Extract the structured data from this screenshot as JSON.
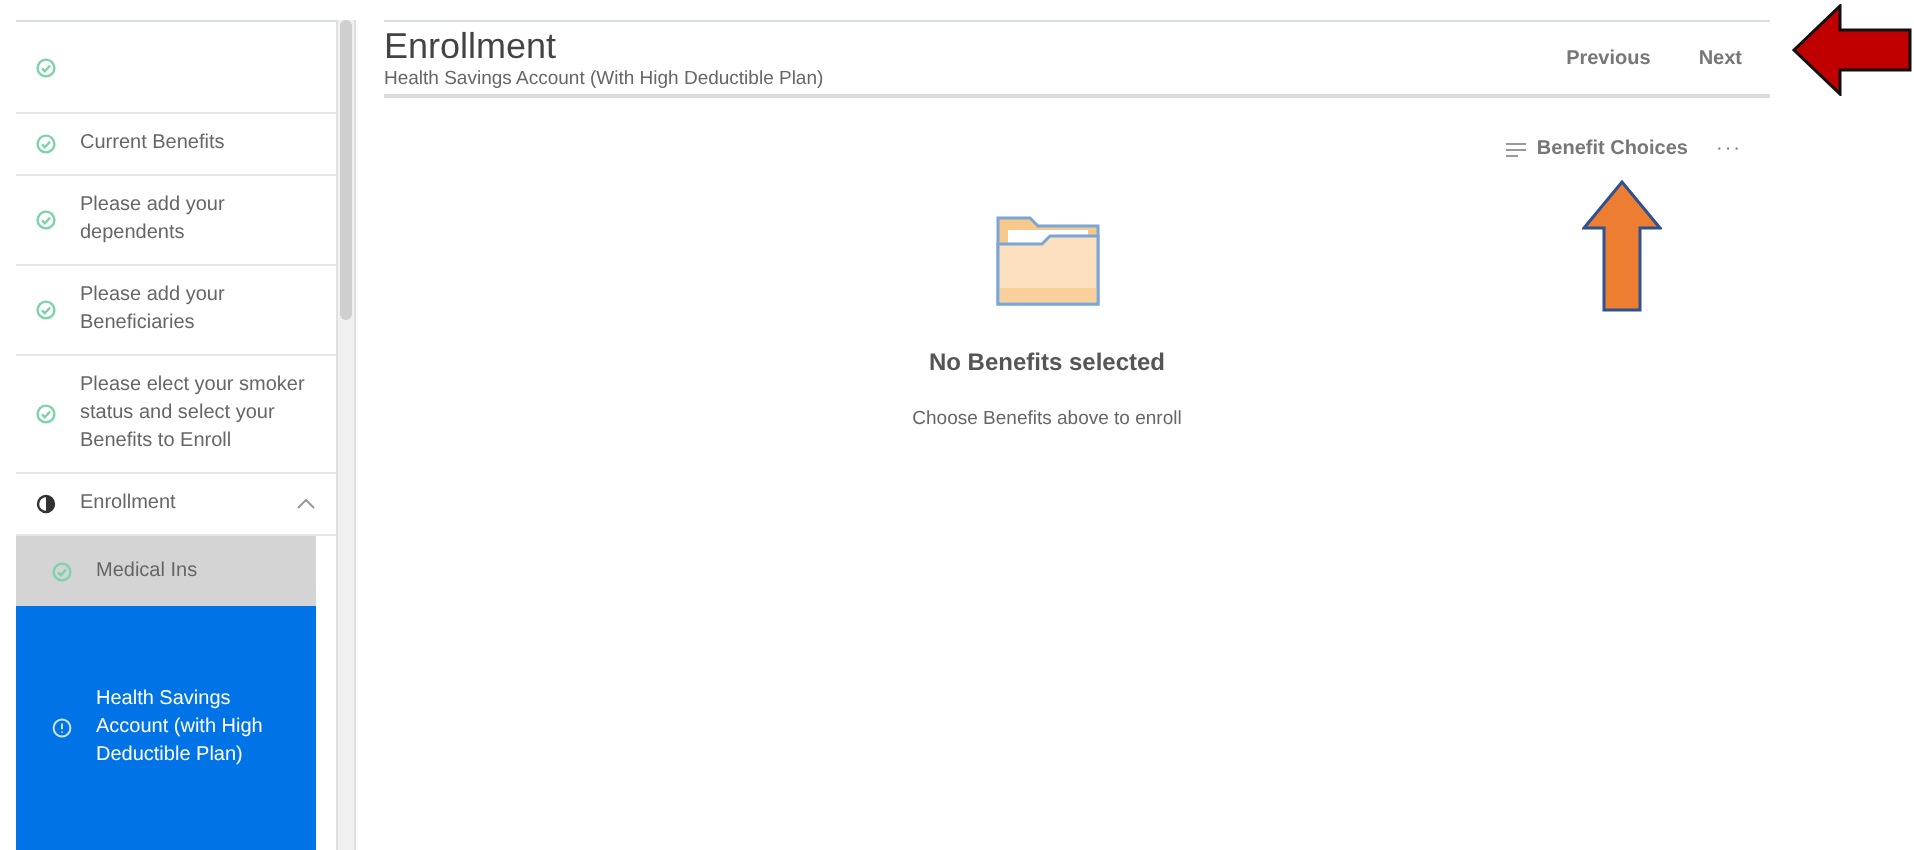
{
  "sidebar": {
    "items": [
      {
        "kind": "complete",
        "selected": false
      },
      {
        "label": "Current Benefits",
        "kind": "complete",
        "selected": false
      },
      {
        "label": "Please add your dependents",
        "kind": "complete",
        "selected": false
      },
      {
        "label": "Please add your Beneficiaries",
        "kind": "complete",
        "selected": false
      },
      {
        "label": "Please elect your smoker status and select your Benefits to Enroll",
        "kind": "complete",
        "selected": false
      },
      {
        "label": "Enrollment",
        "kind": "partial",
        "selected": false,
        "expanded": true,
        "children": [
          {
            "label": "Medical Ins",
            "kind": "complete",
            "selected": false
          },
          {
            "label": "Health Savings Account (with High Deductible Plan)",
            "kind": "info",
            "selected": true
          }
        ]
      }
    ]
  },
  "header": {
    "title": "Enrollment",
    "subtitle": "Health Savings Account (With High Deductible Plan)",
    "nav_buttons": [
      "Previous",
      "Next"
    ]
  },
  "toolbar": {
    "benefit_choices": "Benefit Choices",
    "more": "···"
  },
  "empty_state": {
    "title": "No Benefits selected",
    "message": "Choose Benefits above to enroll"
  },
  "annotations": [
    {
      "kind": "left-arrow",
      "color": "#c00000"
    },
    {
      "kind": "up-arrow",
      "color": "#ed7d31"
    }
  ]
}
